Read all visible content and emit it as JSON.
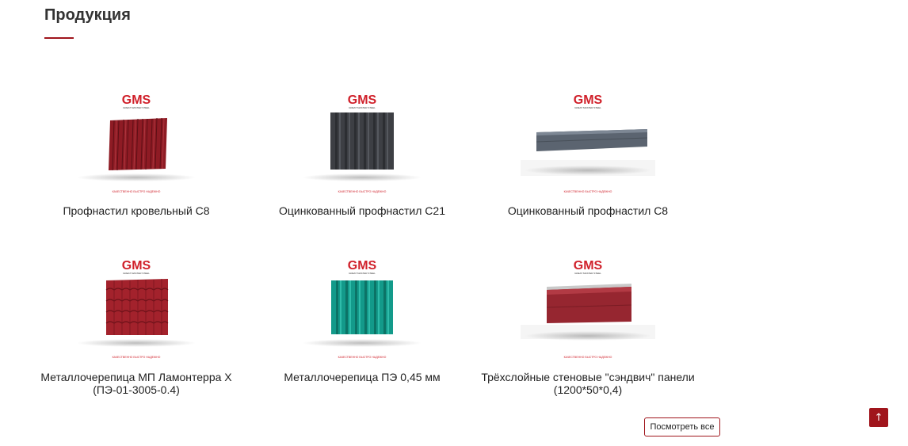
{
  "section": {
    "title": "Продукция"
  },
  "products": [
    {
      "name": "Профнастил кровельный С8",
      "brand": "GMS",
      "color": "#8e1b24",
      "kind": "corrugated-sheet"
    },
    {
      "name": "Оцинкованный профнастил С21",
      "brand": "GMS",
      "color": "#3d3f44",
      "kind": "trapezoid-sheet"
    },
    {
      "name": "Оцинкованный профнастил С8",
      "brand": "GMS",
      "color": "#5b6470",
      "kind": "flat-panel"
    },
    {
      "name": "Металлочерепица МП Ламонтерра X (ПЭ-01-3005-0.4)",
      "brand": "GMS",
      "color": "#a3222c",
      "kind": "metal-tile"
    },
    {
      "name": "Металлочерепица ПЭ 0,45 мм",
      "brand": "GMS",
      "color": "#139a8a",
      "kind": "trapezoid-sheet"
    },
    {
      "name": "Трёхслойные стеновые \"сэндвич\" панели (1200*50*0,4)",
      "brand": "GMS",
      "color": "#962630",
      "kind": "sandwich-panel"
    }
  ],
  "actions": {
    "view_all": "Посмотреть все",
    "to_top_icon": "↑"
  },
  "colors": {
    "accent": "#a0151c",
    "brand_red": "#d0202a"
  }
}
